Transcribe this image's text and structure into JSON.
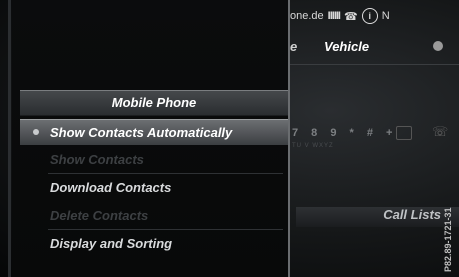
{
  "status_bar": {
    "carrier_fragment": "one.de",
    "signal": "IIIIII",
    "network_letter": "N",
    "info_icon": "i"
  },
  "tabs": {
    "fragment": "e",
    "vehicle": "Vehicle"
  },
  "keypad": {
    "keys": "7 8 9 * # +",
    "subtext": "TU V  WXYZ"
  },
  "call_lists": "Call Lists",
  "bottom_hints": [
    "",
    ""
  ],
  "side_code": "P82.89-1721-31",
  "menu": {
    "title": "Mobile Phone",
    "items": [
      {
        "label": "Show Contacts Automatically",
        "state": "selected"
      },
      {
        "label": "Show Contacts",
        "state": "disabled"
      },
      {
        "label": "Download Contacts",
        "state": "enabled"
      },
      {
        "label": "Delete Contacts",
        "state": "disabled"
      },
      {
        "label": "Display and Sorting",
        "state": "enabled"
      }
    ]
  }
}
